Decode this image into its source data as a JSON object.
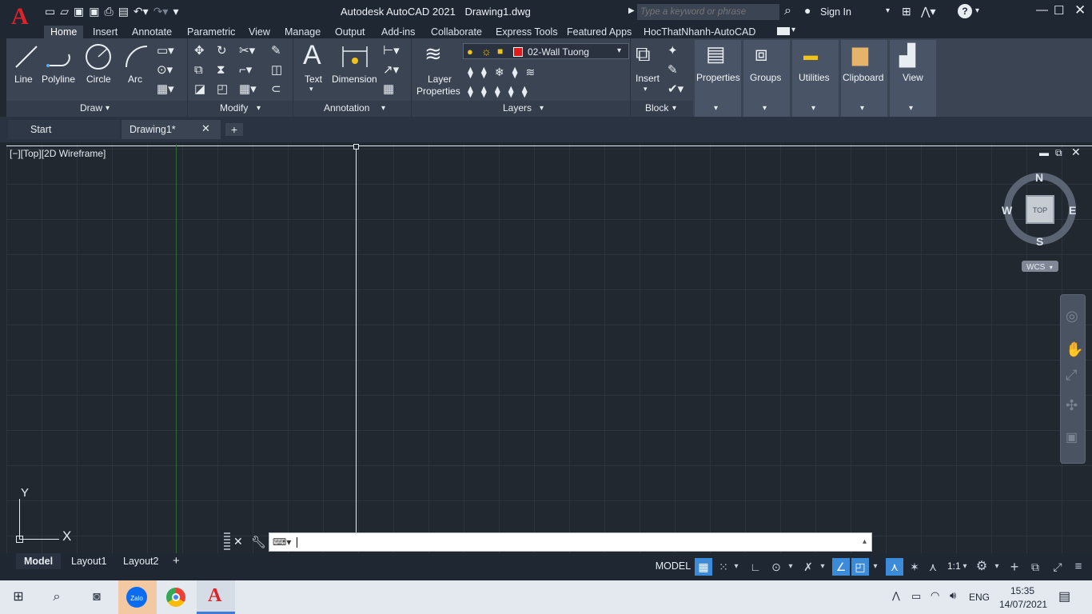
{
  "app": {
    "title": "Autodesk AutoCAD 2021",
    "filename": "Drawing1.dwg",
    "search_placeholder": "Type a keyword or phrase",
    "sign_in": "Sign In",
    "logo": "A"
  },
  "ribbon_tabs": [
    "Home",
    "Insert",
    "Annotate",
    "Parametric",
    "View",
    "Manage",
    "Output",
    "Add-ins",
    "Collaborate",
    "Express Tools",
    "Featured Apps",
    "HocThatNhanh-AutoCAD"
  ],
  "draw": {
    "title": "Draw",
    "line": "Line",
    "polyline": "Polyline",
    "circle": "Circle",
    "arc": "Arc"
  },
  "modify": {
    "title": "Modify"
  },
  "annotation": {
    "title": "Annotation",
    "text": "Text",
    "dimension": "Dimension"
  },
  "layers": {
    "title": "Layers",
    "layer_properties_1": "Layer",
    "layer_properties_2": "Properties",
    "current_layer": "02-Wall Tuong",
    "layer_color": "#e31a1a"
  },
  "block": {
    "title": "Block",
    "insert": "Insert"
  },
  "panels": {
    "properties": "Properties",
    "groups": "Groups",
    "utilities": "Utilities",
    "clipboard": "Clipboard",
    "view": "View"
  },
  "doc_tabs": {
    "start": "Start",
    "drawing": "Drawing1*"
  },
  "viewport": {
    "label": "[−][Top][2D Wireframe]"
  },
  "viewcube": {
    "n": "N",
    "s": "S",
    "e": "E",
    "w": "W",
    "face": "TOP",
    "wcs": "WCS"
  },
  "ucs": {
    "x": "X",
    "y": "Y"
  },
  "layout_tabs": {
    "model": "Model",
    "layout1": "Layout1",
    "layout2": "Layout2"
  },
  "status": {
    "model": "MODEL",
    "scale": "1:1"
  },
  "taskbar": {
    "lang": "ENG",
    "time": "15:35",
    "date": "14/07/2021",
    "zalo": "Zalo"
  }
}
